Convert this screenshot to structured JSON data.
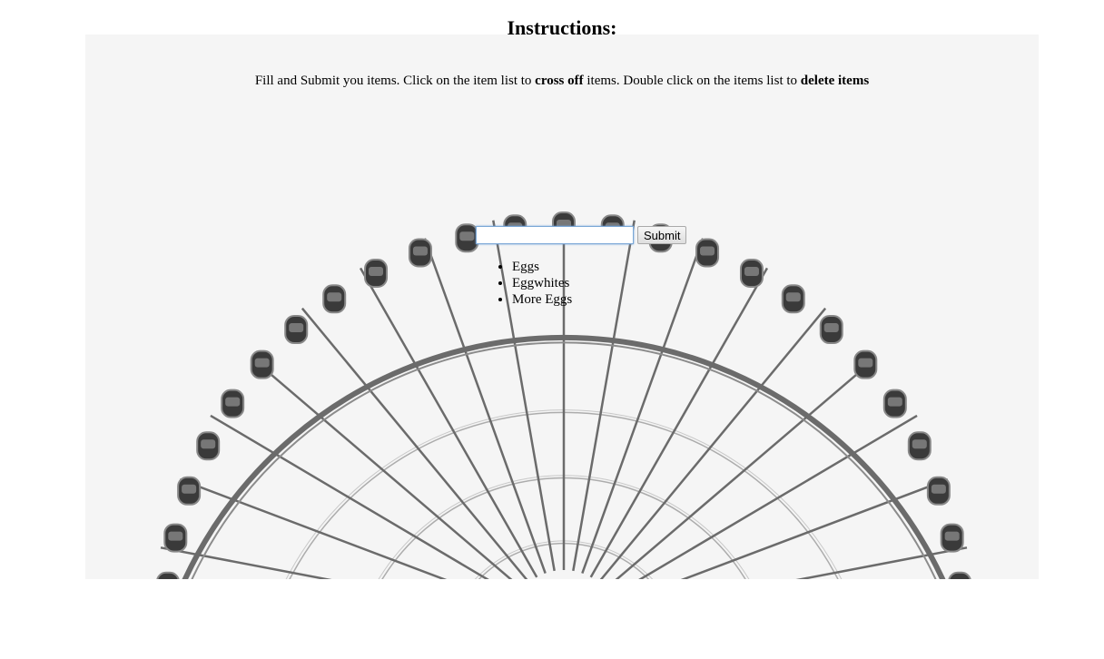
{
  "page": {
    "title": "Instructions:",
    "instructions": {
      "part1": "Fill and Submit you items. Click on the item list to ",
      "bold1": "cross off",
      "part2": " items. Double click on the items list to ",
      "bold2": "delete items"
    }
  },
  "form": {
    "input_value": "",
    "submit_label": "Submit"
  },
  "items": [
    "Eggs",
    "Eggwhites",
    "More Eggs"
  ],
  "colors": {
    "panel_background": "#f5f5f5",
    "wheel_structure": "#6b6b6b",
    "gondola": "#3a3a3a"
  },
  "background_image": "ferris-wheel-photo"
}
